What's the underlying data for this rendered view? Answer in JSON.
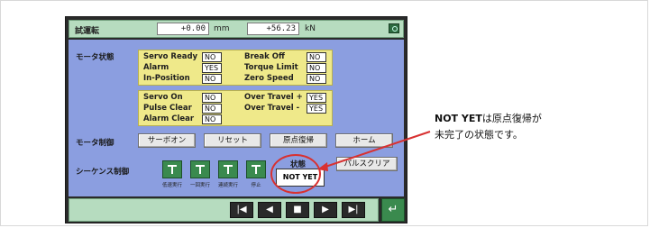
{
  "title": "試運転",
  "position_value": "+0.00",
  "position_unit": "mm",
  "force_value": "+56.23",
  "force_unit": "kN",
  "motor_status_label": "モータ状態",
  "status_group1": [
    {
      "label": "Servo Ready",
      "value": "NO"
    },
    {
      "label": "Alarm",
      "value": "YES"
    },
    {
      "label": "In-Position",
      "value": "NO"
    },
    {
      "label": "Break Off",
      "value": "NO"
    },
    {
      "label": "Torque Limit",
      "value": "NO"
    },
    {
      "label": "Zero Speed",
      "value": "NO"
    }
  ],
  "status_group2": [
    {
      "label": "Servo On",
      "value": "NO"
    },
    {
      "label": "Pulse Clear",
      "value": "NO"
    },
    {
      "label": "Alarm Clear",
      "value": "NO"
    },
    {
      "label": "Over Travel +",
      "value": "YES"
    },
    {
      "label": "Over Travel -",
      "value": "YES"
    }
  ],
  "motor_control_label": "モータ制御",
  "motor_buttons": [
    "サーボオン",
    "リセット",
    "原点復帰",
    "ホーム"
  ],
  "sequence_label": "シーケンス制御",
  "sequence_buttons": [
    "低速実行",
    "一回実行",
    "連続実行",
    "停止"
  ],
  "state_label": "状態",
  "state_value": "NOT YET",
  "pulse_clear_button": "パルスクリア",
  "nav_buttons": [
    "|◀",
    "◀",
    "■",
    "▶",
    "▶|"
  ],
  "return_button": "↵",
  "annotation_bold": "NOT YET",
  "annotation_line1_rest": "は原点復帰が",
  "annotation_line2": "未完了の状態です。",
  "colors": {
    "panel_bg": "#8b9ee0",
    "status_bg": "#efe98a",
    "bar_bg": "#b6dcbf",
    "accent_red": "#d83131"
  }
}
